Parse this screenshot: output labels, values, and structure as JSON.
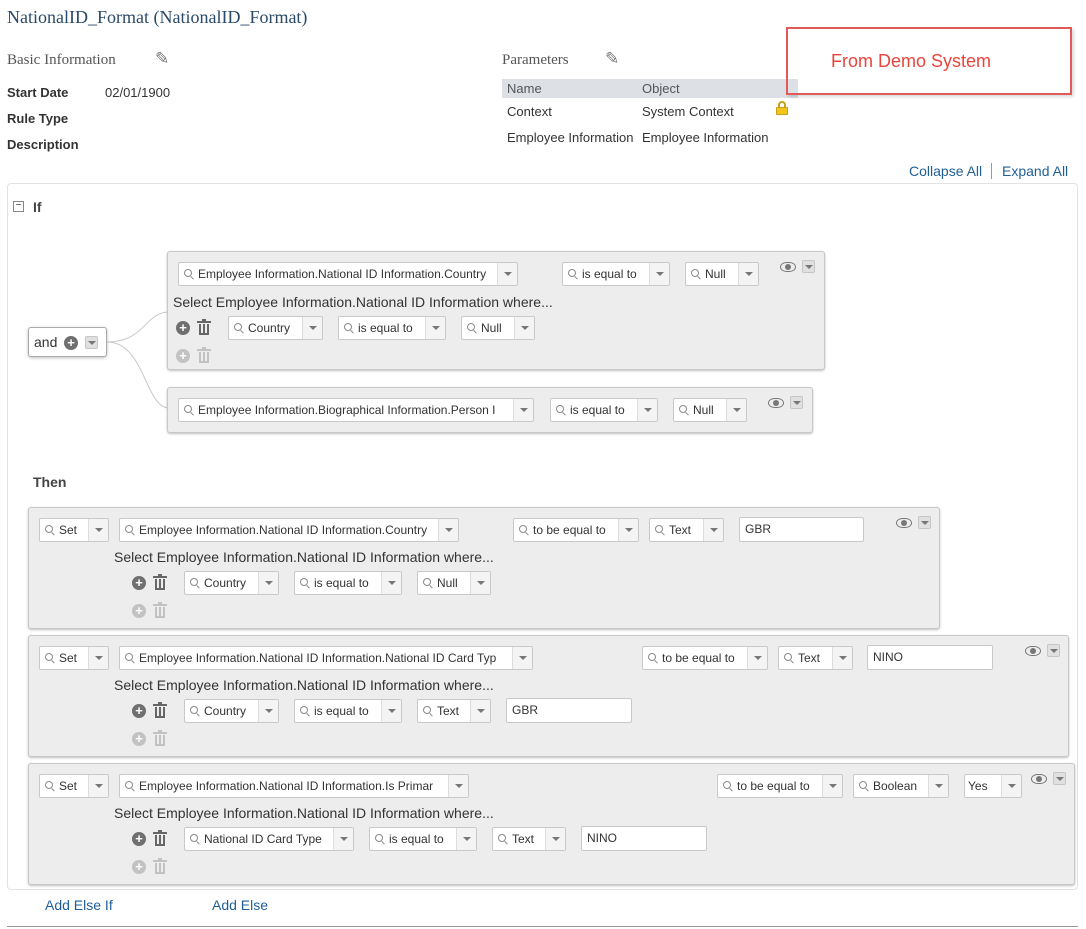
{
  "page_title": "NationalID_Format (NationalID_Format)",
  "basic_info": {
    "heading": "Basic Information",
    "start_date_label": "Start Date",
    "start_date_value": "02/01/1900",
    "rule_type_label": "Rule Type",
    "description_label": "Description"
  },
  "parameters": {
    "heading": "Parameters",
    "columns": [
      "Name",
      "Object"
    ],
    "rows": [
      {
        "name": "Context",
        "object": "System Context"
      },
      {
        "name": "Employee Information",
        "object": "Employee Information"
      }
    ]
  },
  "annotation": "From Demo System",
  "toolbar": {
    "collapse_all": "Collapse All",
    "expand_all": "Expand All"
  },
  "if_label": "If",
  "then_label": "Then",
  "and_label": "and",
  "select_where_text": "Select Employee Information.National ID Information where...",
  "if_conditions": [
    {
      "field": "Employee Information.National ID Information.Country",
      "operator": "is equal to",
      "value": "Null",
      "sub": {
        "field": "Country",
        "operator": "is equal to",
        "value": "Null"
      }
    },
    {
      "field": "Employee Information.Biographical Information.Person I",
      "operator": "is equal to",
      "value": "Null"
    }
  ],
  "then_actions": [
    {
      "verb": "Set",
      "field": "Employee Information.National ID Information.Country",
      "operator": "to be equal to",
      "type": "Text",
      "value": "GBR",
      "sub": {
        "field": "Country",
        "operator": "is equal to",
        "type": "Null",
        "value": ""
      }
    },
    {
      "verb": "Set",
      "field": "Employee Information.National ID Information.National ID Card Typ",
      "operator": "to be equal to",
      "type": "Text",
      "value": "NINO",
      "sub": {
        "field": "Country",
        "operator": "is equal to",
        "type": "Text",
        "value": "GBR"
      }
    },
    {
      "verb": "Set",
      "field": "Employee Information.National ID Information.Is Primar",
      "operator": "to be equal to",
      "type": "Boolean",
      "value": "Yes",
      "sub": {
        "field": "National ID Card Type",
        "operator": "is equal to",
        "type": "Text",
        "value": "NINO"
      }
    }
  ],
  "footer": {
    "add_else_if": "Add Else If",
    "add_else": "Add Else"
  },
  "icons": [
    "pencil-icon",
    "lock-icon",
    "search-icon",
    "chevron-down-icon",
    "add-icon",
    "trash-icon",
    "eye-icon",
    "collapse-icon"
  ],
  "colors": {
    "title": "#2a4a68",
    "link": "#1f5f99",
    "annotation": "#e8453c",
    "panel_bg": "#ededed"
  }
}
